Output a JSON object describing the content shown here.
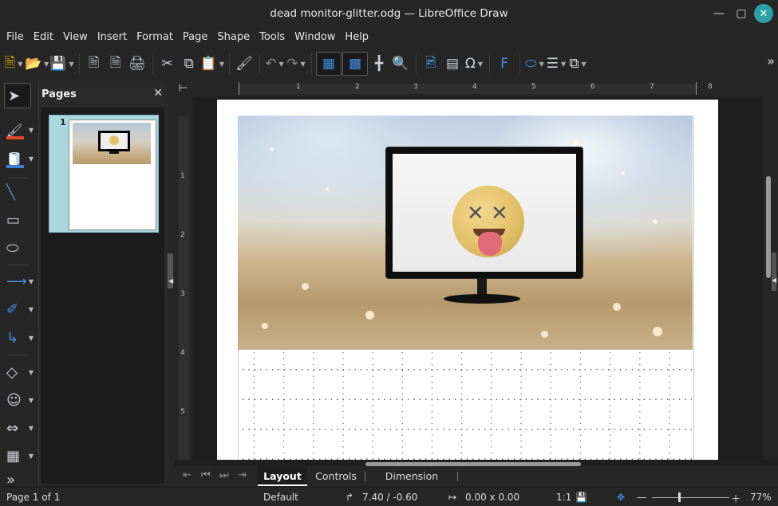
{
  "window": {
    "title": "dead monitor-glitter.odg — LibreOffice Draw",
    "minimize_icon": "minimize-icon",
    "maximize_icon": "maximize-icon",
    "close_icon": "close-icon"
  },
  "menu": {
    "items": [
      "File",
      "Edit",
      "View",
      "Insert",
      "Format",
      "Page",
      "Shape",
      "Tools",
      "Window",
      "Help"
    ]
  },
  "toolbar": {
    "icons": [
      "new-icon",
      "open-icon",
      "save-icon",
      "export-icon",
      "export-pdf-icon",
      "print-icon",
      "cut-icon",
      "copy-icon",
      "paste-icon",
      "clone-formatting-icon",
      "undo-icon",
      "redo-icon",
      "display-grid-icon",
      "snap-to-grid-icon",
      "helplines-icon",
      "zoom-pan-icon",
      "insert-image-icon",
      "insert-textbox-icon",
      "special-character-icon",
      "fontwork-icon",
      "transformations-icon",
      "align-icon",
      "arrange-icon",
      "more-icon"
    ]
  },
  "tools": {
    "icons": [
      "select-icon",
      "line-color-icon",
      "fill-color-icon",
      "line-icon",
      "rectangle-icon",
      "ellipse-icon",
      "lines-arrows-icon",
      "curves-polygons-icon",
      "connectors-icon",
      "basic-shapes-icon",
      "symbol-shapes-icon",
      "block-arrows-icon",
      "flowchart-icon",
      "more-tools-icon"
    ]
  },
  "pages_pane": {
    "header": "Pages",
    "close_icon": "close-icon",
    "pages": [
      {
        "number": "1"
      }
    ]
  },
  "ruler": {
    "h_labels": [
      "1",
      "2",
      "3",
      "4",
      "5",
      "6",
      "7",
      "8"
    ],
    "v_labels": [
      "1",
      "2",
      "3",
      "4",
      "5"
    ]
  },
  "tabs": {
    "items": [
      "Layout",
      "Controls",
      "Dimension Lines"
    ],
    "active": "Layout"
  },
  "status": {
    "page": "Page 1 of 1",
    "style": "Default",
    "position": "7.40 / -0.60",
    "size": "0.00 x 0.00",
    "scale": "1:1",
    "zoom": "77%"
  },
  "colors": {
    "line_color_swatch": "#e8432f",
    "fill_color_swatch": "#3d7ed6",
    "accent": "#2aa1a8"
  }
}
